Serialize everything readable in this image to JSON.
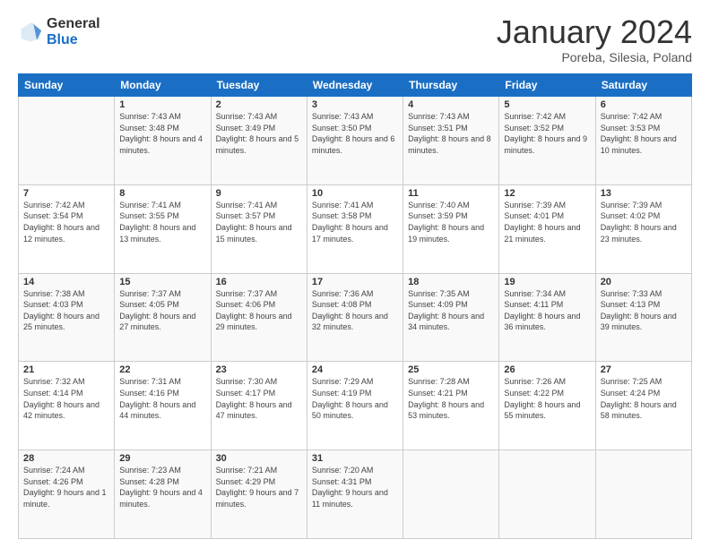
{
  "logo": {
    "general": "General",
    "blue": "Blue"
  },
  "header": {
    "month": "January 2024",
    "location": "Poreba, Silesia, Poland"
  },
  "weekdays": [
    "Sunday",
    "Monday",
    "Tuesday",
    "Wednesday",
    "Thursday",
    "Friday",
    "Saturday"
  ],
  "weeks": [
    [
      {
        "day": "",
        "sunrise": "",
        "sunset": "",
        "daylight": ""
      },
      {
        "day": "1",
        "sunrise": "Sunrise: 7:43 AM",
        "sunset": "Sunset: 3:48 PM",
        "daylight": "Daylight: 8 hours and 4 minutes."
      },
      {
        "day": "2",
        "sunrise": "Sunrise: 7:43 AM",
        "sunset": "Sunset: 3:49 PM",
        "daylight": "Daylight: 8 hours and 5 minutes."
      },
      {
        "day": "3",
        "sunrise": "Sunrise: 7:43 AM",
        "sunset": "Sunset: 3:50 PM",
        "daylight": "Daylight: 8 hours and 6 minutes."
      },
      {
        "day": "4",
        "sunrise": "Sunrise: 7:43 AM",
        "sunset": "Sunset: 3:51 PM",
        "daylight": "Daylight: 8 hours and 8 minutes."
      },
      {
        "day": "5",
        "sunrise": "Sunrise: 7:42 AM",
        "sunset": "Sunset: 3:52 PM",
        "daylight": "Daylight: 8 hours and 9 minutes."
      },
      {
        "day": "6",
        "sunrise": "Sunrise: 7:42 AM",
        "sunset": "Sunset: 3:53 PM",
        "daylight": "Daylight: 8 hours and 10 minutes."
      }
    ],
    [
      {
        "day": "7",
        "sunrise": "Sunrise: 7:42 AM",
        "sunset": "Sunset: 3:54 PM",
        "daylight": "Daylight: 8 hours and 12 minutes."
      },
      {
        "day": "8",
        "sunrise": "Sunrise: 7:41 AM",
        "sunset": "Sunset: 3:55 PM",
        "daylight": "Daylight: 8 hours and 13 minutes."
      },
      {
        "day": "9",
        "sunrise": "Sunrise: 7:41 AM",
        "sunset": "Sunset: 3:57 PM",
        "daylight": "Daylight: 8 hours and 15 minutes."
      },
      {
        "day": "10",
        "sunrise": "Sunrise: 7:41 AM",
        "sunset": "Sunset: 3:58 PM",
        "daylight": "Daylight: 8 hours and 17 minutes."
      },
      {
        "day": "11",
        "sunrise": "Sunrise: 7:40 AM",
        "sunset": "Sunset: 3:59 PM",
        "daylight": "Daylight: 8 hours and 19 minutes."
      },
      {
        "day": "12",
        "sunrise": "Sunrise: 7:39 AM",
        "sunset": "Sunset: 4:01 PM",
        "daylight": "Daylight: 8 hours and 21 minutes."
      },
      {
        "day": "13",
        "sunrise": "Sunrise: 7:39 AM",
        "sunset": "Sunset: 4:02 PM",
        "daylight": "Daylight: 8 hours and 23 minutes."
      }
    ],
    [
      {
        "day": "14",
        "sunrise": "Sunrise: 7:38 AM",
        "sunset": "Sunset: 4:03 PM",
        "daylight": "Daylight: 8 hours and 25 minutes."
      },
      {
        "day": "15",
        "sunrise": "Sunrise: 7:37 AM",
        "sunset": "Sunset: 4:05 PM",
        "daylight": "Daylight: 8 hours and 27 minutes."
      },
      {
        "day": "16",
        "sunrise": "Sunrise: 7:37 AM",
        "sunset": "Sunset: 4:06 PM",
        "daylight": "Daylight: 8 hours and 29 minutes."
      },
      {
        "day": "17",
        "sunrise": "Sunrise: 7:36 AM",
        "sunset": "Sunset: 4:08 PM",
        "daylight": "Daylight: 8 hours and 32 minutes."
      },
      {
        "day": "18",
        "sunrise": "Sunrise: 7:35 AM",
        "sunset": "Sunset: 4:09 PM",
        "daylight": "Daylight: 8 hours and 34 minutes."
      },
      {
        "day": "19",
        "sunrise": "Sunrise: 7:34 AM",
        "sunset": "Sunset: 4:11 PM",
        "daylight": "Daylight: 8 hours and 36 minutes."
      },
      {
        "day": "20",
        "sunrise": "Sunrise: 7:33 AM",
        "sunset": "Sunset: 4:13 PM",
        "daylight": "Daylight: 8 hours and 39 minutes."
      }
    ],
    [
      {
        "day": "21",
        "sunrise": "Sunrise: 7:32 AM",
        "sunset": "Sunset: 4:14 PM",
        "daylight": "Daylight: 8 hours and 42 minutes."
      },
      {
        "day": "22",
        "sunrise": "Sunrise: 7:31 AM",
        "sunset": "Sunset: 4:16 PM",
        "daylight": "Daylight: 8 hours and 44 minutes."
      },
      {
        "day": "23",
        "sunrise": "Sunrise: 7:30 AM",
        "sunset": "Sunset: 4:17 PM",
        "daylight": "Daylight: 8 hours and 47 minutes."
      },
      {
        "day": "24",
        "sunrise": "Sunrise: 7:29 AM",
        "sunset": "Sunset: 4:19 PM",
        "daylight": "Daylight: 8 hours and 50 minutes."
      },
      {
        "day": "25",
        "sunrise": "Sunrise: 7:28 AM",
        "sunset": "Sunset: 4:21 PM",
        "daylight": "Daylight: 8 hours and 53 minutes."
      },
      {
        "day": "26",
        "sunrise": "Sunrise: 7:26 AM",
        "sunset": "Sunset: 4:22 PM",
        "daylight": "Daylight: 8 hours and 55 minutes."
      },
      {
        "day": "27",
        "sunrise": "Sunrise: 7:25 AM",
        "sunset": "Sunset: 4:24 PM",
        "daylight": "Daylight: 8 hours and 58 minutes."
      }
    ],
    [
      {
        "day": "28",
        "sunrise": "Sunrise: 7:24 AM",
        "sunset": "Sunset: 4:26 PM",
        "daylight": "Daylight: 9 hours and 1 minute."
      },
      {
        "day": "29",
        "sunrise": "Sunrise: 7:23 AM",
        "sunset": "Sunset: 4:28 PM",
        "daylight": "Daylight: 9 hours and 4 minutes."
      },
      {
        "day": "30",
        "sunrise": "Sunrise: 7:21 AM",
        "sunset": "Sunset: 4:29 PM",
        "daylight": "Daylight: 9 hours and 7 minutes."
      },
      {
        "day": "31",
        "sunrise": "Sunrise: 7:20 AM",
        "sunset": "Sunset: 4:31 PM",
        "daylight": "Daylight: 9 hours and 11 minutes."
      },
      {
        "day": "",
        "sunrise": "",
        "sunset": "",
        "daylight": ""
      },
      {
        "day": "",
        "sunrise": "",
        "sunset": "",
        "daylight": ""
      },
      {
        "day": "",
        "sunrise": "",
        "sunset": "",
        "daylight": ""
      }
    ]
  ]
}
